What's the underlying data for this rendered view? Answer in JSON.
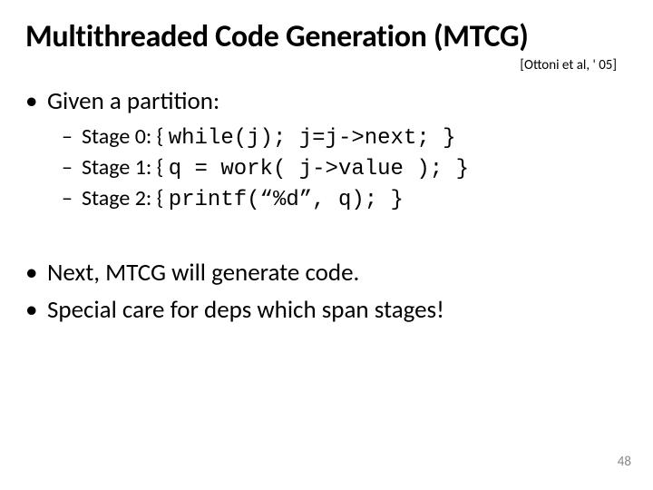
{
  "title": "Multithreaded Code Generation (MTCG)",
  "citation": "[Ottoni et al, ' 05]",
  "b1": "Given a partition:",
  "stages": [
    {
      "label": "Stage 0: { ",
      "code": "while(j);   j=j->next; }"
    },
    {
      "label": "Stage 1: { ",
      "code": "q = work( j->value ); }"
    },
    {
      "label": "Stage 2: { ",
      "code": "printf(“%d”, q); }"
    }
  ],
  "b2": "Next, MTCG will generate code.",
  "b3": "Special care for deps which span stages!",
  "pagenum": "48"
}
